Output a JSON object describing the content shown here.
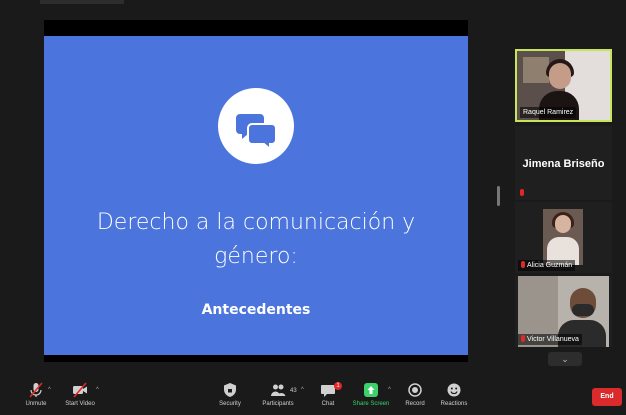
{
  "slide": {
    "title_line1": "Derecho a la comunicación y",
    "title_line2": "género:",
    "subtitle": "Antecedentes"
  },
  "participants": [
    {
      "name": "Raquel Ramirez",
      "video": true,
      "active_speaker": true
    },
    {
      "name": "Jimena Briseño",
      "video": false,
      "muted": true
    },
    {
      "name": "Alicia Guzmán",
      "video": true,
      "muted": true
    },
    {
      "name": "Victor Villanueva",
      "video": true,
      "muted": true
    }
  ],
  "toolbar": {
    "unmute": "Unmute",
    "start_video": "Start Video",
    "security": "Security",
    "participants": "Participants",
    "participants_count": "43",
    "chat": "Chat",
    "chat_badge": "1",
    "share_screen": "Share Screen",
    "record": "Record",
    "reactions": "Reactions",
    "end": "End"
  },
  "colors": {
    "slide_bg": "#4b75dc",
    "active_speaker_border": "#c7e55b",
    "share_green": "#3bd26a",
    "end_red": "#d92b2b"
  }
}
